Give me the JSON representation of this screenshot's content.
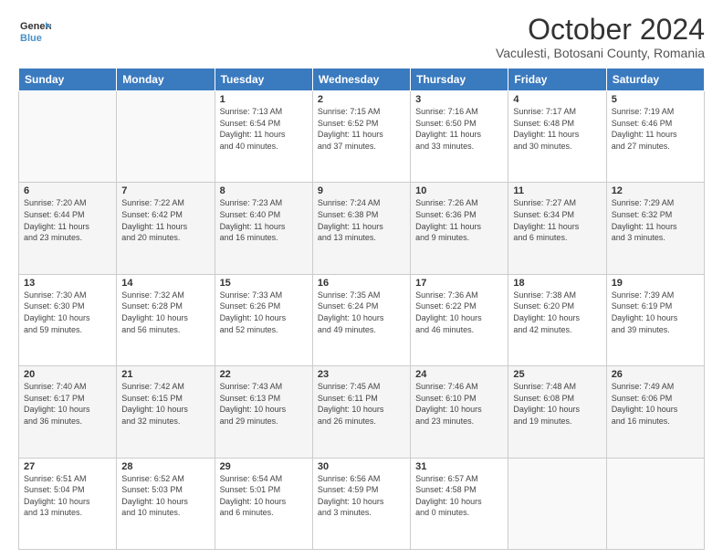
{
  "header": {
    "logo_line1": "General",
    "logo_line2": "Blue",
    "month_title": "October 2024",
    "location": "Vaculesti, Botosani County, Romania"
  },
  "weekdays": [
    "Sunday",
    "Monday",
    "Tuesday",
    "Wednesday",
    "Thursday",
    "Friday",
    "Saturday"
  ],
  "weeks": [
    [
      {
        "day": "",
        "info": ""
      },
      {
        "day": "",
        "info": ""
      },
      {
        "day": "1",
        "info": "Sunrise: 7:13 AM\nSunset: 6:54 PM\nDaylight: 11 hours\nand 40 minutes."
      },
      {
        "day": "2",
        "info": "Sunrise: 7:15 AM\nSunset: 6:52 PM\nDaylight: 11 hours\nand 37 minutes."
      },
      {
        "day": "3",
        "info": "Sunrise: 7:16 AM\nSunset: 6:50 PM\nDaylight: 11 hours\nand 33 minutes."
      },
      {
        "day": "4",
        "info": "Sunrise: 7:17 AM\nSunset: 6:48 PM\nDaylight: 11 hours\nand 30 minutes."
      },
      {
        "day": "5",
        "info": "Sunrise: 7:19 AM\nSunset: 6:46 PM\nDaylight: 11 hours\nand 27 minutes."
      }
    ],
    [
      {
        "day": "6",
        "info": "Sunrise: 7:20 AM\nSunset: 6:44 PM\nDaylight: 11 hours\nand 23 minutes."
      },
      {
        "day": "7",
        "info": "Sunrise: 7:22 AM\nSunset: 6:42 PM\nDaylight: 11 hours\nand 20 minutes."
      },
      {
        "day": "8",
        "info": "Sunrise: 7:23 AM\nSunset: 6:40 PM\nDaylight: 11 hours\nand 16 minutes."
      },
      {
        "day": "9",
        "info": "Sunrise: 7:24 AM\nSunset: 6:38 PM\nDaylight: 11 hours\nand 13 minutes."
      },
      {
        "day": "10",
        "info": "Sunrise: 7:26 AM\nSunset: 6:36 PM\nDaylight: 11 hours\nand 9 minutes."
      },
      {
        "day": "11",
        "info": "Sunrise: 7:27 AM\nSunset: 6:34 PM\nDaylight: 11 hours\nand 6 minutes."
      },
      {
        "day": "12",
        "info": "Sunrise: 7:29 AM\nSunset: 6:32 PM\nDaylight: 11 hours\nand 3 minutes."
      }
    ],
    [
      {
        "day": "13",
        "info": "Sunrise: 7:30 AM\nSunset: 6:30 PM\nDaylight: 10 hours\nand 59 minutes."
      },
      {
        "day": "14",
        "info": "Sunrise: 7:32 AM\nSunset: 6:28 PM\nDaylight: 10 hours\nand 56 minutes."
      },
      {
        "day": "15",
        "info": "Sunrise: 7:33 AM\nSunset: 6:26 PM\nDaylight: 10 hours\nand 52 minutes."
      },
      {
        "day": "16",
        "info": "Sunrise: 7:35 AM\nSunset: 6:24 PM\nDaylight: 10 hours\nand 49 minutes."
      },
      {
        "day": "17",
        "info": "Sunrise: 7:36 AM\nSunset: 6:22 PM\nDaylight: 10 hours\nand 46 minutes."
      },
      {
        "day": "18",
        "info": "Sunrise: 7:38 AM\nSunset: 6:20 PM\nDaylight: 10 hours\nand 42 minutes."
      },
      {
        "day": "19",
        "info": "Sunrise: 7:39 AM\nSunset: 6:19 PM\nDaylight: 10 hours\nand 39 minutes."
      }
    ],
    [
      {
        "day": "20",
        "info": "Sunrise: 7:40 AM\nSunset: 6:17 PM\nDaylight: 10 hours\nand 36 minutes."
      },
      {
        "day": "21",
        "info": "Sunrise: 7:42 AM\nSunset: 6:15 PM\nDaylight: 10 hours\nand 32 minutes."
      },
      {
        "day": "22",
        "info": "Sunrise: 7:43 AM\nSunset: 6:13 PM\nDaylight: 10 hours\nand 29 minutes."
      },
      {
        "day": "23",
        "info": "Sunrise: 7:45 AM\nSunset: 6:11 PM\nDaylight: 10 hours\nand 26 minutes."
      },
      {
        "day": "24",
        "info": "Sunrise: 7:46 AM\nSunset: 6:10 PM\nDaylight: 10 hours\nand 23 minutes."
      },
      {
        "day": "25",
        "info": "Sunrise: 7:48 AM\nSunset: 6:08 PM\nDaylight: 10 hours\nand 19 minutes."
      },
      {
        "day": "26",
        "info": "Sunrise: 7:49 AM\nSunset: 6:06 PM\nDaylight: 10 hours\nand 16 minutes."
      }
    ],
    [
      {
        "day": "27",
        "info": "Sunrise: 6:51 AM\nSunset: 5:04 PM\nDaylight: 10 hours\nand 13 minutes."
      },
      {
        "day": "28",
        "info": "Sunrise: 6:52 AM\nSunset: 5:03 PM\nDaylight: 10 hours\nand 10 minutes."
      },
      {
        "day": "29",
        "info": "Sunrise: 6:54 AM\nSunset: 5:01 PM\nDaylight: 10 hours\nand 6 minutes."
      },
      {
        "day": "30",
        "info": "Sunrise: 6:56 AM\nSunset: 4:59 PM\nDaylight: 10 hours\nand 3 minutes."
      },
      {
        "day": "31",
        "info": "Sunrise: 6:57 AM\nSunset: 4:58 PM\nDaylight: 10 hours\nand 0 minutes."
      },
      {
        "day": "",
        "info": ""
      },
      {
        "day": "",
        "info": ""
      }
    ]
  ]
}
